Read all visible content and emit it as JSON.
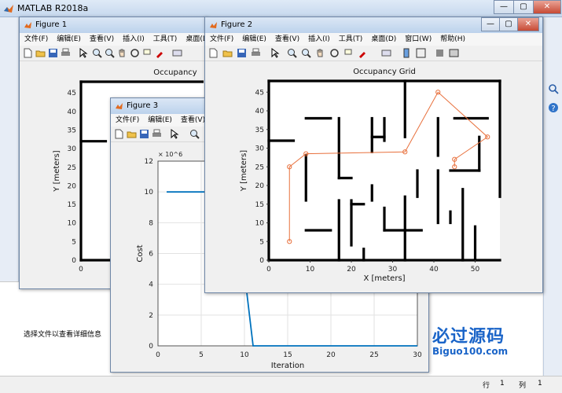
{
  "app": {
    "title": "MATLAB R2018a",
    "minimize": "—",
    "maximize": "▢",
    "close": "✕"
  },
  "menus": [
    "文件(F)",
    "编辑(E)",
    "查看(V)",
    "插入(I)",
    "工具(T)",
    "桌面(D)",
    "窗口(W)",
    "帮助(H)"
  ],
  "figure1": {
    "title": "Figure 1",
    "menus": [
      "文件(F)",
      "编辑(E)",
      "查看(V)",
      "插入(I)",
      "工具(T)",
      "桌面(D)"
    ],
    "axes_title": "Occupancy",
    "ylabel": "Y [meters]",
    "yticks": [
      "45",
      "40",
      "35",
      "30",
      "25",
      "20",
      "15",
      "10",
      "5",
      "0"
    ],
    "xticks": [
      "0"
    ]
  },
  "figure2": {
    "title": "Figure 2",
    "chart_data": {
      "type": "line",
      "title": "Occupancy Grid",
      "xlabel": "X [meters]",
      "ylabel": "Y [meters]",
      "xlim": [
        0,
        56
      ],
      "ylim": [
        0,
        48
      ],
      "xticks": [
        0,
        10,
        20,
        30,
        40,
        50
      ],
      "yticks": [
        0,
        5,
        10,
        15,
        20,
        25,
        30,
        35,
        40,
        45
      ],
      "series": [
        {
          "x": [
            5,
            5,
            9,
            33,
            41,
            53,
            45,
            45
          ],
          "y": [
            5,
            25,
            28.5,
            29,
            45,
            33,
            27,
            25
          ],
          "color": "#e8703c"
        }
      ],
      "walls": [
        [
          [
            0,
            48
          ],
          [
            56,
            48
          ]
        ],
        [
          [
            0,
            0
          ],
          [
            56,
            0
          ]
        ],
        [
          [
            0,
            0
          ],
          [
            0,
            48
          ]
        ],
        [
          [
            56,
            17
          ],
          [
            56,
            48
          ]
        ],
        [
          [
            0,
            32
          ],
          [
            6,
            32
          ]
        ],
        [
          [
            9,
            28
          ],
          [
            9,
            16
          ]
        ],
        [
          [
            9,
            38
          ],
          [
            15,
            38
          ]
        ],
        [
          [
            17,
            38
          ],
          [
            17,
            22
          ]
        ],
        [
          [
            17,
            22
          ],
          [
            20,
            22
          ]
        ],
        [
          [
            17,
            16
          ],
          [
            17,
            0
          ]
        ],
        [
          [
            9,
            8
          ],
          [
            15,
            8
          ]
        ],
        [
          [
            20,
            15
          ],
          [
            23,
            15
          ]
        ],
        [
          [
            20,
            4
          ],
          [
            20,
            16
          ]
        ],
        [
          [
            23,
            3
          ],
          [
            23,
            0
          ]
        ],
        [
          [
            25,
            16
          ],
          [
            25,
            20
          ]
        ],
        [
          [
            25,
            29
          ],
          [
            25,
            38
          ]
        ],
        [
          [
            25,
            33
          ],
          [
            28,
            33
          ]
        ],
        [
          [
            28,
            38
          ],
          [
            28,
            32
          ]
        ],
        [
          [
            33,
            48
          ],
          [
            33,
            33
          ]
        ],
        [
          [
            33,
            17
          ],
          [
            33,
            0
          ]
        ],
        [
          [
            28,
            8
          ],
          [
            37,
            8
          ]
        ],
        [
          [
            41,
            38
          ],
          [
            41,
            28
          ]
        ],
        [
          [
            41,
            10
          ],
          [
            41,
            24
          ]
        ],
        [
          [
            44,
            24
          ],
          [
            51,
            24
          ]
        ],
        [
          [
            47,
            19
          ],
          [
            47,
            0
          ]
        ],
        [
          [
            50,
            9
          ],
          [
            50,
            0
          ]
        ],
        [
          [
            45,
            38
          ],
          [
            53,
            38
          ]
        ],
        [
          [
            51,
            33
          ],
          [
            51,
            24
          ]
        ],
        [
          [
            44,
            13
          ],
          [
            44,
            10
          ]
        ],
        [
          [
            36,
            24
          ],
          [
            36,
            17
          ]
        ],
        [
          [
            28,
            14
          ],
          [
            28,
            8
          ]
        ]
      ]
    }
  },
  "figure3": {
    "title": "Figure 3",
    "menus": [
      "文件(F)",
      "编辑(E)",
      "查看(V)"
    ],
    "chart_data": {
      "type": "line",
      "title": "",
      "xlabel": "Iteration",
      "ylabel": "Cost",
      "exponent": "× 10^6",
      "xlim": [
        0,
        30
      ],
      "ylim": [
        0,
        12
      ],
      "xticks": [
        0,
        5,
        10,
        15,
        20,
        25,
        30
      ],
      "yticks": [
        0,
        2,
        4,
        6,
        8,
        10,
        12
      ],
      "series": [
        {
          "x": [
            1,
            10.2,
            10.2,
            11,
            30
          ],
          "y": [
            10,
            10,
            3.8,
            0,
            0
          ],
          "color": "#0072bd"
        }
      ]
    }
  },
  "detail_message": "选择文件以查看详细信息",
  "status": {
    "row_label": "行",
    "row": "1",
    "col_label": "列",
    "col": "1"
  },
  "watermark": {
    "name": "必过源码",
    "url": "Biguo100.com"
  }
}
